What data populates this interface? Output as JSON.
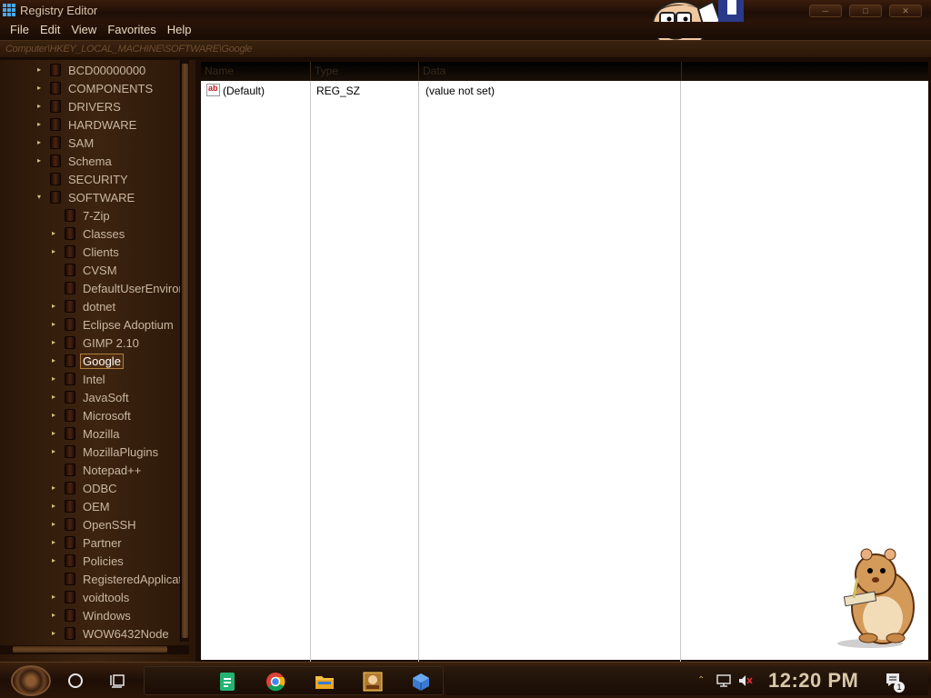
{
  "window": {
    "title": "Registry Editor"
  },
  "titlebar_buttons": [
    "minimize",
    "maximize",
    "close"
  ],
  "menu": [
    "File",
    "Edit",
    "View",
    "Favorites",
    "Help"
  ],
  "address": "Computer\\HKEY_LOCAL_MACHINE\\SOFTWARE\\Google",
  "tree": {
    "level1": [
      {
        "label": "BCD00000000",
        "expandable": true
      },
      {
        "label": "COMPONENTS",
        "expandable": true
      },
      {
        "label": "DRIVERS",
        "expandable": true
      },
      {
        "label": "HARDWARE",
        "expandable": true
      },
      {
        "label": "SAM",
        "expandable": true
      },
      {
        "label": "Schema",
        "expandable": true
      },
      {
        "label": "SECURITY",
        "expandable": false
      },
      {
        "label": "SOFTWARE",
        "expandable": true,
        "expanded": true
      }
    ],
    "level2": [
      {
        "label": "7-Zip",
        "expandable": false
      },
      {
        "label": "Classes",
        "expandable": true
      },
      {
        "label": "Clients",
        "expandable": true
      },
      {
        "label": "CVSM",
        "expandable": false
      },
      {
        "label": "DefaultUserEnviror",
        "expandable": false
      },
      {
        "label": "dotnet",
        "expandable": true
      },
      {
        "label": "Eclipse Adoptium",
        "expandable": true
      },
      {
        "label": "GIMP 2.10",
        "expandable": true
      },
      {
        "label": "Google",
        "expandable": true,
        "selected": true
      },
      {
        "label": "Intel",
        "expandable": true
      },
      {
        "label": "JavaSoft",
        "expandable": true
      },
      {
        "label": "Microsoft",
        "expandable": true
      },
      {
        "label": "Mozilla",
        "expandable": true
      },
      {
        "label": "MozillaPlugins",
        "expandable": true
      },
      {
        "label": "Notepad++",
        "expandable": false
      },
      {
        "label": "ODBC",
        "expandable": true
      },
      {
        "label": "OEM",
        "expandable": true
      },
      {
        "label": "OpenSSH",
        "expandable": true
      },
      {
        "label": "Partner",
        "expandable": true
      },
      {
        "label": "Policies",
        "expandable": true
      },
      {
        "label": "RegisteredApplicat",
        "expandable": false
      },
      {
        "label": "voidtools",
        "expandable": true
      },
      {
        "label": "Windows",
        "expandable": true
      },
      {
        "label": "WOW6432Node",
        "expandable": true
      }
    ]
  },
  "list": {
    "columns": [
      "Name",
      "Type",
      "Data"
    ],
    "rows": [
      {
        "name": "(Default)",
        "type": "REG_SZ",
        "data": "(value not set)"
      }
    ]
  },
  "taskbar": {
    "pinned": [
      "sheets-icon",
      "chrome-icon",
      "file-explorer-icon",
      "sandbox-icon",
      "cube-app-icon"
    ],
    "clock": "12:20 PM",
    "notification_count": "1"
  }
}
